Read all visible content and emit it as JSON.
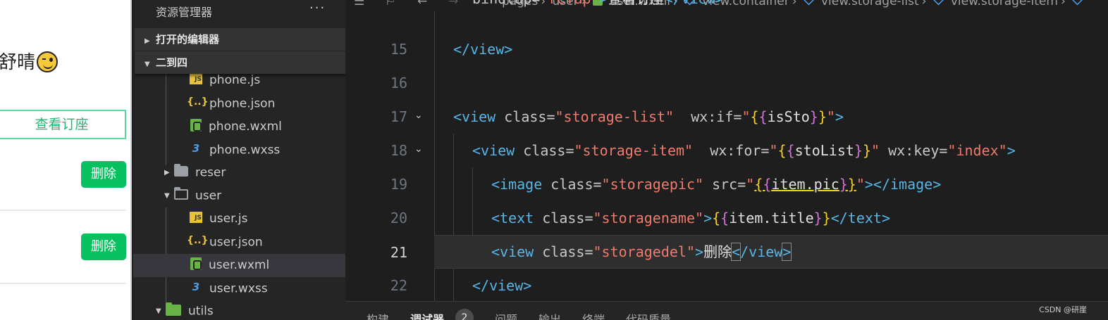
{
  "simulator": {
    "greeting": "舒晴",
    "emoji_icon": "winking-face-icon",
    "order_button": "查看订座",
    "delete_button": "删除"
  },
  "explorer": {
    "title": "资源管理器",
    "more": "···",
    "sections": {
      "open_editors": "打开的编辑器",
      "project": "二到四"
    },
    "items": [
      {
        "label": "phone.js",
        "icon": "js-file-icon"
      },
      {
        "label": "phone.json",
        "icon": "json-file-icon"
      },
      {
        "label": "phone.wxml",
        "icon": "wxml-file-icon"
      },
      {
        "label": "phone.wxss",
        "icon": "wxss-file-icon"
      },
      {
        "label": "reser",
        "icon": "folder-icon"
      },
      {
        "label": "user",
        "icon": "folder-open-icon"
      },
      {
        "label": "user.js",
        "icon": "js-file-icon"
      },
      {
        "label": "user.json",
        "icon": "json-file-icon"
      },
      {
        "label": "user.wxml",
        "icon": "wxml-file-icon"
      },
      {
        "label": "user.wxss",
        "icon": "wxss-file-icon"
      },
      {
        "label": "utils",
        "icon": "folder-icon"
      }
    ]
  },
  "toolbar": {
    "crumbs": [
      "pages",
      "user",
      "user.wxml",
      "view.container",
      "view.storage-list",
      "view.storage-item"
    ]
  },
  "editor": {
    "current_line": 21,
    "lines": [
      {
        "no": "",
        "text": "bindtap=\"reTap\">查看订座</view>"
      },
      {
        "no": 15,
        "text": "</view>"
      },
      {
        "no": 16,
        "text": ""
      },
      {
        "no": 17,
        "text": "<view class=\"storage-list\"  wx:if=\"{{isSto}}\">"
      },
      {
        "no": 18,
        "text": "<view class=\"storage-item\"  wx:for=\"{{stoList}}\" wx:key=\"index\">"
      },
      {
        "no": 19,
        "text": "<image class=\"storagepic\" src=\"{{item.pic}}\"></image>"
      },
      {
        "no": 20,
        "text": "<text class=\"storagename\">{{item.title}}</text>"
      },
      {
        "no": 21,
        "text": "<view class=\"storagedel\">删除</view>"
      },
      {
        "no": 22,
        "text": "</view>"
      }
    ]
  },
  "bottom_panel": {
    "tabs": [
      "构建",
      "调试器",
      "问题",
      "输出",
      "终端",
      "代码质量"
    ],
    "debugger_badge": "2",
    "watermark": "CSDN @研崖"
  },
  "colors": {
    "tag": "#56b6e8",
    "string": "#ef7a6c",
    "brace_outer": "#f5d020",
    "brace_inner": "#d670d6",
    "wechat_green": "#07c160"
  }
}
